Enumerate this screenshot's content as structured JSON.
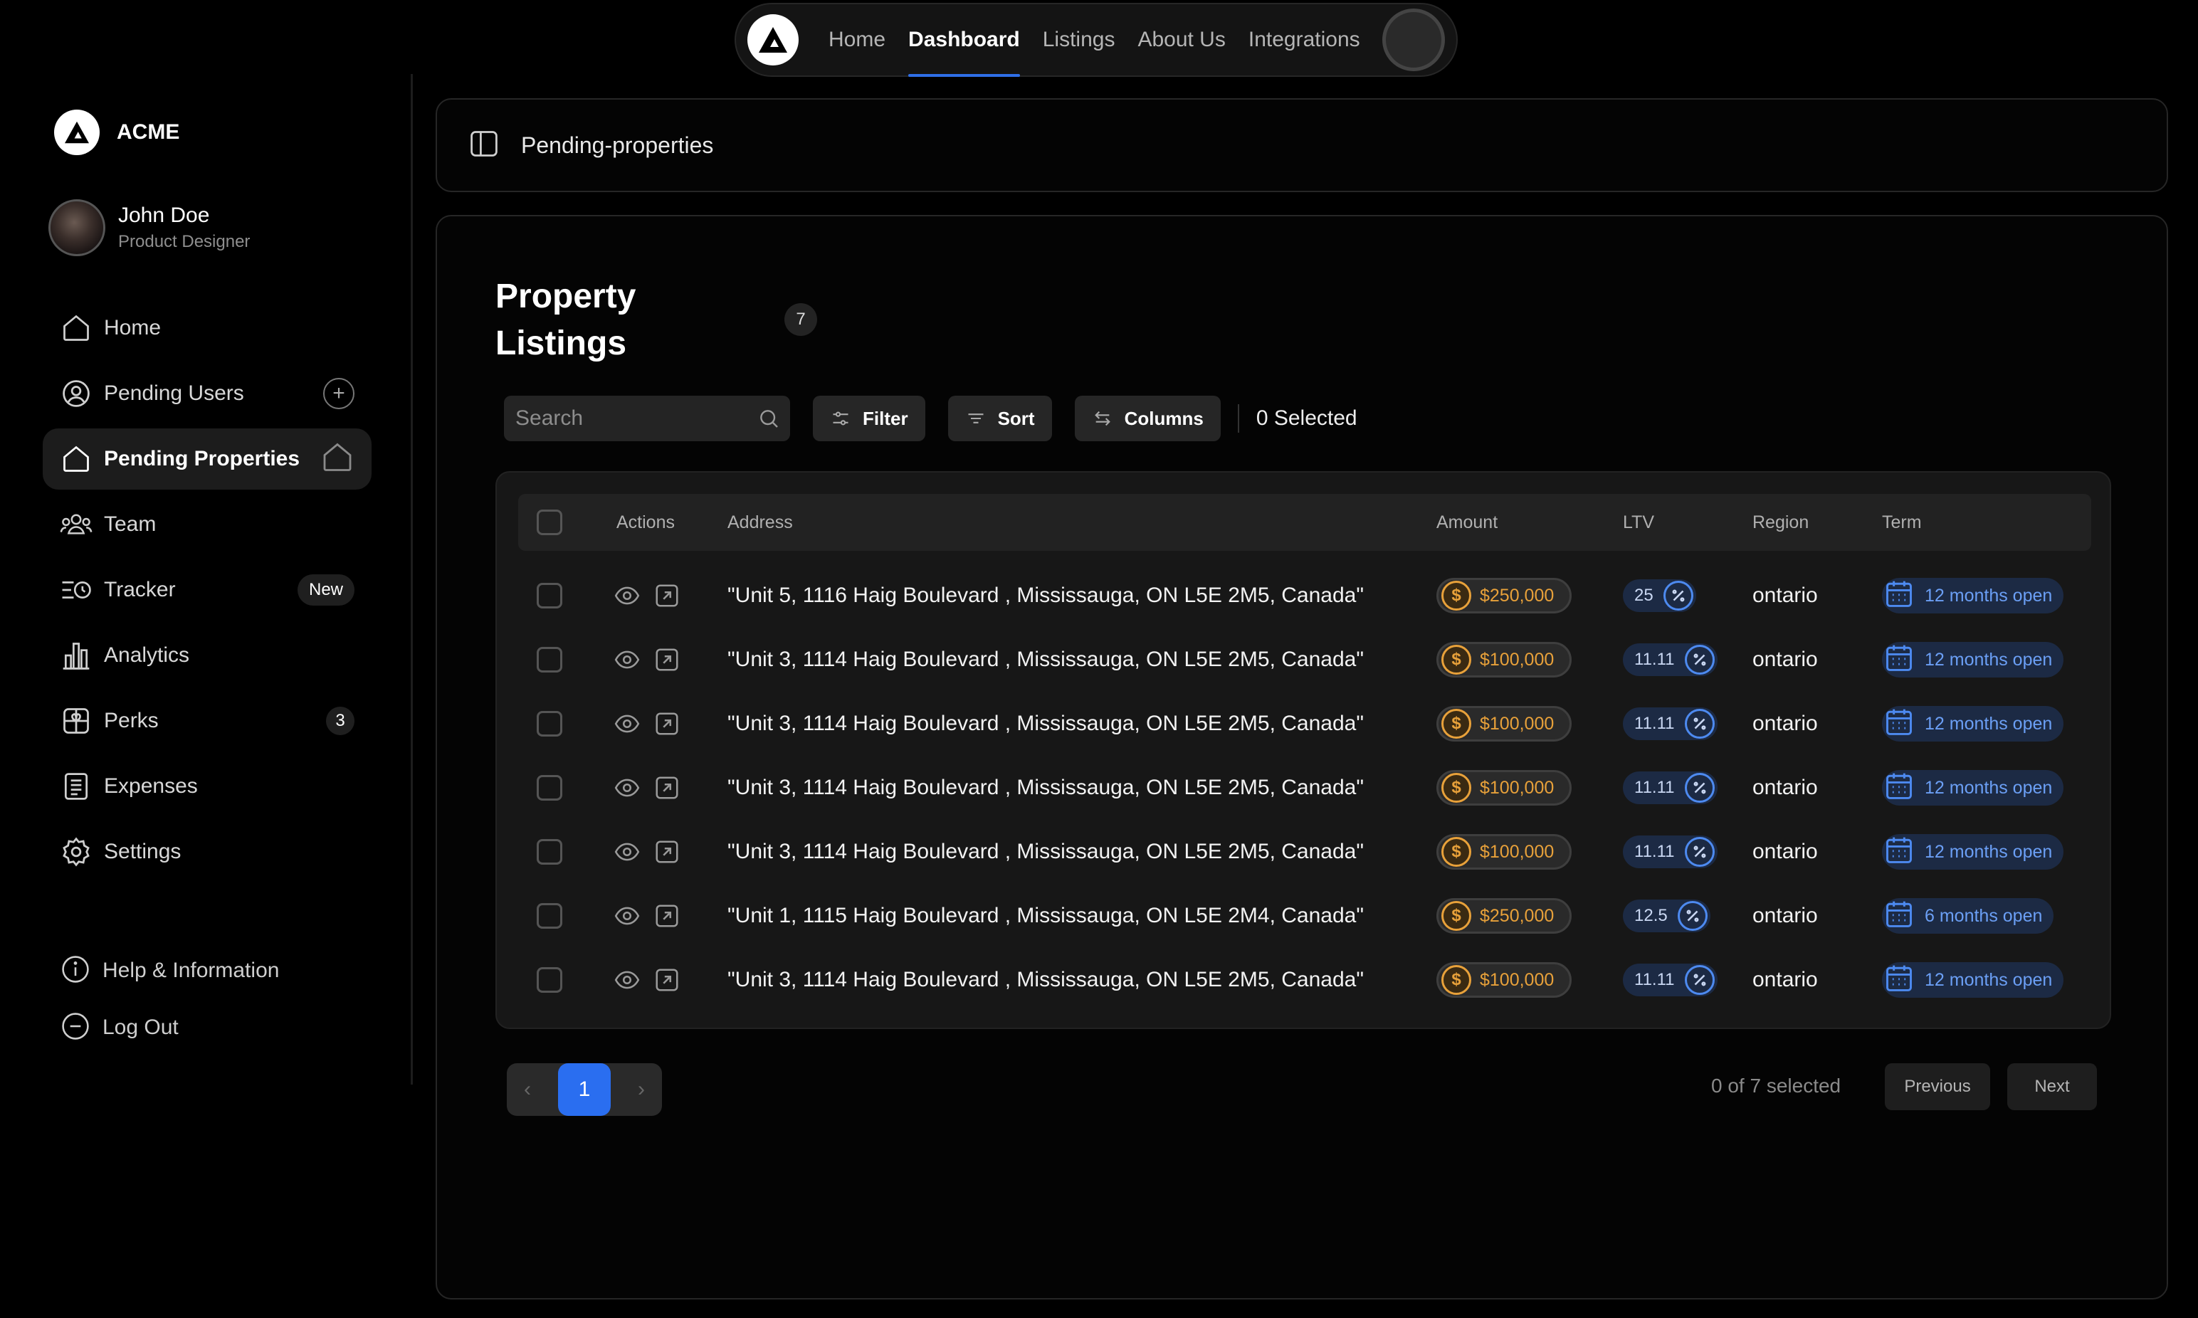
{
  "topnav": {
    "links": [
      "Home",
      "Dashboard",
      "Listings",
      "About Us",
      "Integrations"
    ],
    "active": "Dashboard"
  },
  "sidebar": {
    "brand": "ACME",
    "user": {
      "name": "John Doe",
      "role": "Product Designer"
    },
    "items": [
      {
        "label": "Home",
        "icon": "home-icon"
      },
      {
        "label": "Pending Users",
        "icon": "user-circle-icon",
        "trail": "plus"
      },
      {
        "label": "Pending Properties",
        "icon": "home-icon",
        "trail": "home",
        "active": true
      },
      {
        "label": "Team",
        "icon": "team-icon"
      },
      {
        "label": "Tracker",
        "icon": "tracker-icon",
        "badge": "New"
      },
      {
        "label": "Analytics",
        "icon": "bar-chart-icon"
      },
      {
        "label": "Perks",
        "icon": "gift-icon",
        "badge": "3"
      },
      {
        "label": "Expenses",
        "icon": "receipt-icon"
      },
      {
        "label": "Settings",
        "icon": "gear-icon"
      }
    ],
    "footer": [
      {
        "label": "Help & Information",
        "icon": "info-icon"
      },
      {
        "label": "Log Out",
        "icon": "logout-icon"
      }
    ]
  },
  "header": {
    "title": "Pending-properties"
  },
  "main": {
    "title": "Property Listings",
    "count": "7",
    "search_placeholder": "Search",
    "filter_label": "Filter",
    "sort_label": "Sort",
    "columns_label": "Columns",
    "selected_label": "0 Selected",
    "columns": [
      "Actions",
      "Address",
      "Amount",
      "LTV",
      "Region",
      "Term"
    ],
    "rows": [
      {
        "address": "\"Unit 5, 1116 Haig Boulevard , Mississauga, ON L5E 2M5, Canada\"",
        "amount": "$250,000",
        "ltv": "25",
        "region": "ontario",
        "term": "12 months open"
      },
      {
        "address": "\"Unit 3, 1114 Haig Boulevard , Mississauga, ON L5E 2M5, Canada\"",
        "amount": "$100,000",
        "ltv": "11.11",
        "region": "ontario",
        "term": "12 months open"
      },
      {
        "address": "\"Unit 3, 1114 Haig Boulevard , Mississauga, ON L5E 2M5, Canada\"",
        "amount": "$100,000",
        "ltv": "11.11",
        "region": "ontario",
        "term": "12 months open"
      },
      {
        "address": "\"Unit 3, 1114 Haig Boulevard , Mississauga, ON L5E 2M5, Canada\"",
        "amount": "$100,000",
        "ltv": "11.11",
        "region": "ontario",
        "term": "12 months open"
      },
      {
        "address": "\"Unit 3, 1114 Haig Boulevard , Mississauga, ON L5E 2M5, Canada\"",
        "amount": "$100,000",
        "ltv": "11.11",
        "region": "ontario",
        "term": "12 months open"
      },
      {
        "address": "\"Unit 1, 1115 Haig Boulevard , Mississauga, ON L5E 2M4, Canada\"",
        "amount": "$250,000",
        "ltv": "12.5",
        "region": "ontario",
        "term": "6 months open"
      },
      {
        "address": "\"Unit 3, 1114 Haig Boulevard , Mississauga, ON L5E 2M5, Canada\"",
        "amount": "$100,000",
        "ltv": "11.11",
        "region": "ontario",
        "term": "12 months open"
      }
    ],
    "pagination": {
      "current_page": "1",
      "selection_info": "0 of 7 selected",
      "previous_label": "Previous",
      "next_label": "Next"
    }
  },
  "colors": {
    "accent": "#2f6fe8",
    "amount": "#e8a13a",
    "term": "#6b9ff5"
  }
}
